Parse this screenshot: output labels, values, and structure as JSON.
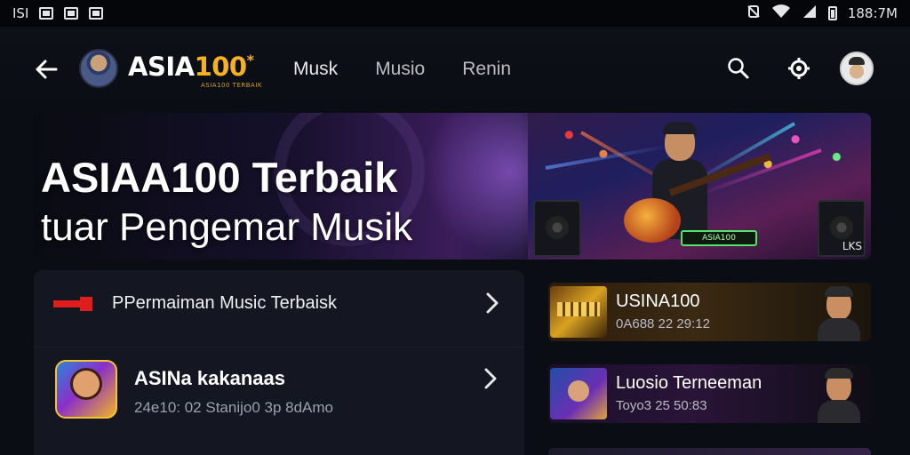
{
  "status_bar": {
    "left_text": "ISI",
    "time": "188:7M"
  },
  "header": {
    "brand_part1": "ASIA",
    "brand_part2": "100",
    "brand_star": "*",
    "brand_tagline": "ASIA100 TERBAIK",
    "nav": [
      "Musk",
      "Musio",
      "Renin"
    ]
  },
  "hero": {
    "title_line1": "ASIAA100  Terbaik",
    "title_line2": "tuar Pengemar Musik",
    "badge_text": "ASIA100",
    "corner_text": "LKS"
  },
  "list": {
    "row1_label": "PPermaiman Music Terbaisk",
    "row2_title": "ASINa kakanaas",
    "row2_subtitle": "24e10: 02 Stanijo0 3p 8dAmo"
  },
  "cards": [
    {
      "title": "USINA100",
      "subtitle": "0A688 22 29:12"
    },
    {
      "title": "Luosio Terneeman",
      "subtitle": "Toyo3 25 50:83"
    }
  ],
  "colors": {
    "background": "#0b0d14",
    "brand_gold": "#f5b21c",
    "accent_red": "#e01d1d"
  }
}
